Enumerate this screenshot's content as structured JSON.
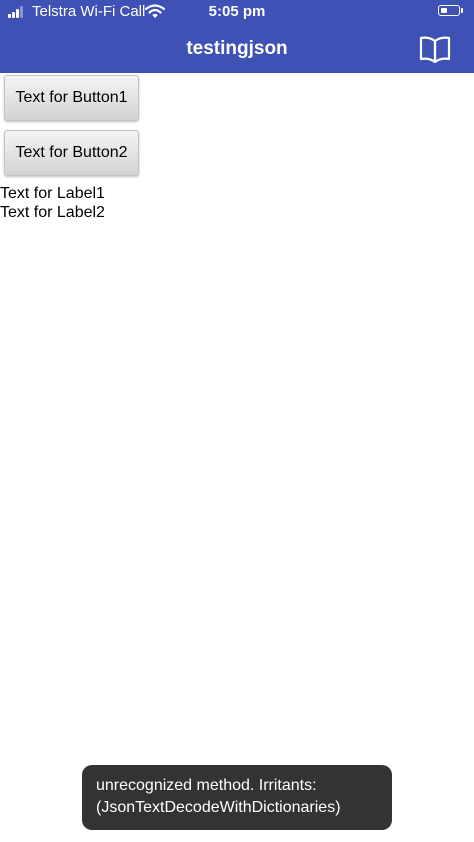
{
  "status_bar": {
    "carrier": "Telstra Wi-Fi Call",
    "time": "5:05 pm"
  },
  "nav": {
    "title": "testingjson",
    "right_icon": "book-icon"
  },
  "buttons": [
    {
      "label": "Text for Button1"
    },
    {
      "label": "Text for Button2"
    }
  ],
  "labels": [
    {
      "text": "Text for Label1"
    },
    {
      "text": "Text for Label2"
    }
  ],
  "toast": {
    "line1": "unrecognized method. Irritants:",
    "line2": "(JsonTextDecodeWithDictionaries)"
  },
  "colors": {
    "nav_bar": "#3f51b5",
    "toast_bg": "#333333",
    "button_gradient_top": "#f4f4f4",
    "button_gradient_bottom": "#d3d3d3"
  }
}
